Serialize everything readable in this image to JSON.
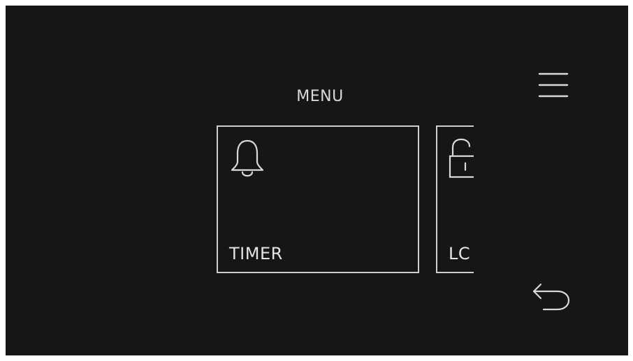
{
  "menu": {
    "title": "MENU",
    "tiles": [
      {
        "label": "TIMER",
        "icon": "bell-icon"
      },
      {
        "label": "LC",
        "icon": "unlocked-padlock-icon"
      }
    ]
  },
  "controls": {
    "menu_icon": "hamburger-menu-icon",
    "back_icon": "back-arrow-icon"
  },
  "colors": {
    "background": "#181615",
    "foreground": "#d9d9d9",
    "frame": "#ffffff"
  }
}
